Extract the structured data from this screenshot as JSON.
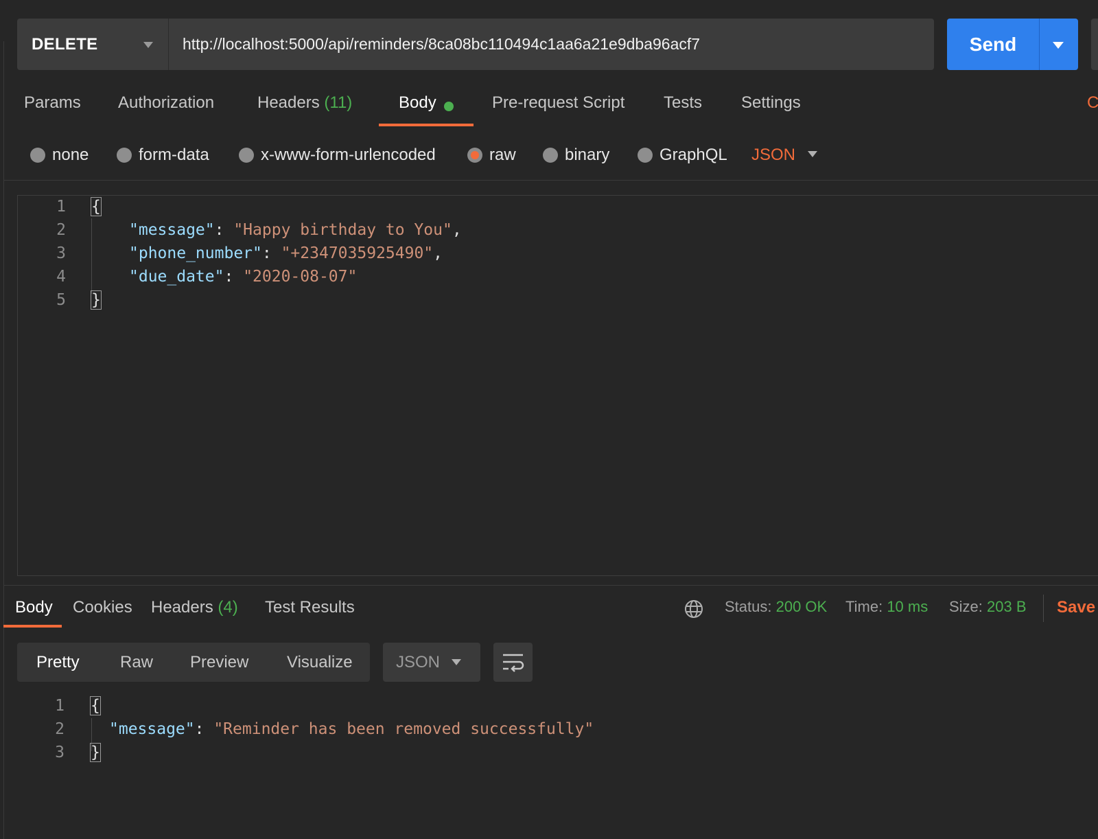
{
  "request": {
    "method": "DELETE",
    "url": "http://localhost:5000/api/reminders/8ca08bc110494c1aa6a21e9dba96acf7",
    "send_label": "Send"
  },
  "request_tabs": {
    "params": "Params",
    "authorization": "Authorization",
    "headers": "Headers",
    "headers_count": "(11)",
    "body": "Body",
    "pre_request": "Pre-request Script",
    "tests": "Tests",
    "settings": "Settings",
    "edge": "C"
  },
  "body_modes": {
    "none": "none",
    "form_data": "form-data",
    "urlencoded": "x-www-form-urlencoded",
    "raw": "raw",
    "binary": "binary",
    "graphql": "GraphQL",
    "format": "JSON"
  },
  "request_body": {
    "line_numbers": [
      "1",
      "2",
      "3",
      "4",
      "5"
    ],
    "open_brace": "{",
    "close_brace": "}",
    "fields": [
      {
        "key": "\"message\"",
        "value": "\"Happy birthday to You\"",
        "trail": ","
      },
      {
        "key": "\"phone_number\"",
        "value": "\"+2347035925490\"",
        "trail": ","
      },
      {
        "key": "\"due_date\"",
        "value": "\"2020-08-07\"",
        "trail": ""
      }
    ]
  },
  "response_tabs": {
    "body": "Body",
    "cookies": "Cookies",
    "headers": "Headers",
    "headers_count": "(4)",
    "test_results": "Test Results"
  },
  "response_meta": {
    "status_label": "Status:",
    "status_value": "200 OK",
    "time_label": "Time:",
    "time_value": "10 ms",
    "size_label": "Size:",
    "size_value": "203 B",
    "save_label": "Save"
  },
  "view_modes": {
    "pretty": "Pretty",
    "raw": "Raw",
    "preview": "Preview",
    "visualize": "Visualize",
    "format": "JSON"
  },
  "response_body": {
    "line_numbers": [
      "1",
      "2",
      "3"
    ],
    "open_brace": "{",
    "close_brace": "}",
    "key": "\"message\"",
    "value": "\"Reminder has been removed successfully\""
  },
  "colors": {
    "accent": "#f26b3a",
    "send": "#2f80ed",
    "success": "#4caf50",
    "json_key": "#9cdcfe",
    "json_string": "#ce9178"
  }
}
